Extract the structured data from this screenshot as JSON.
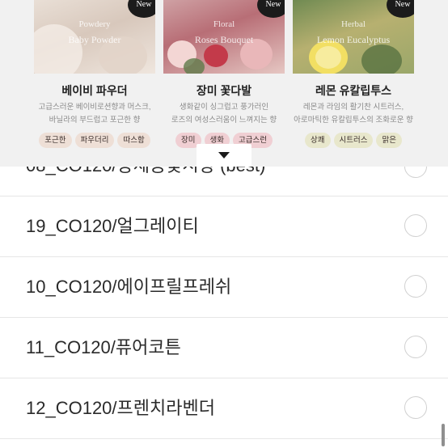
{
  "products": [
    {
      "image_sub": "Powdery",
      "image_name": "Baby Powder",
      "badge": "New",
      "title": "베이비 파우더",
      "desc": [
        "고급스러운 베이비로션향과 머스크,",
        "바닐라의 부드럽고 포근한 향"
      ],
      "tags": [
        "포근한",
        "파우더리",
        "따스함"
      ]
    },
    {
      "image_sub": "Floral",
      "image_name": "Roses Bouquet",
      "badge": "New",
      "title": "장미 꽃다발",
      "desc": [
        "생화같이 싱그럽고 풍가러인",
        "로즈의 여성스러움이 느껴지는 향"
      ],
      "tags": [
        "장미",
        "생화",
        "고급스런"
      ]
    },
    {
      "image_sub": "Herbal",
      "image_name": "Lemon Eucalyptus",
      "badge": "New",
      "title": "레몬 유칼립투스",
      "desc": [
        "레몬과 라임의 활기찬 시트러스,",
        "아로마틱한 유칼립투스의 조화로운 향"
      ],
      "tags": [
        "상쾌",
        "시트러스",
        "맑은"
      ]
    }
  ],
  "options": [
    {
      "label": "08_CO120/장세등꽃시향 (best)"
    },
    {
      "label": "19_CO120/얼그레이티"
    },
    {
      "label": "10_CO120/에이프릴프레쉬"
    },
    {
      "label": "11_CO120/퓨어코튼"
    },
    {
      "label": "12_CO120/프렌치라벤더"
    }
  ],
  "icons": {
    "collapse": "caret-down-icon",
    "radio": "radio-circle-icon"
  },
  "colors": {
    "overlay_bg": "#f1f1f1",
    "badge_bg": "#1b1b1b",
    "tag_powder": "#eedfd6",
    "tag_rose": "#f0cfd3",
    "tag_lemon": "#e8e7cc"
  }
}
